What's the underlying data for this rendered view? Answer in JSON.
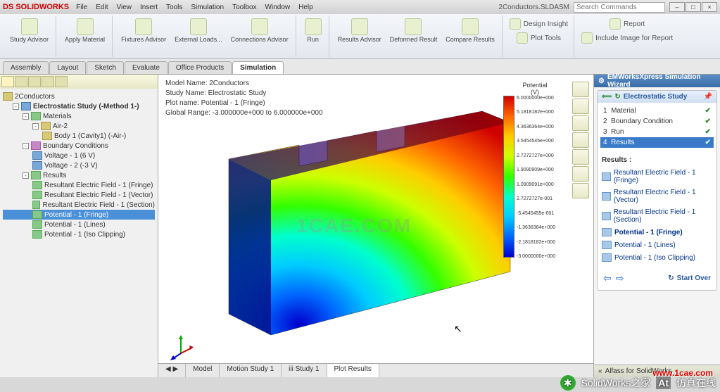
{
  "app": {
    "logo": "DS SOLIDWORKS",
    "document": "2Conductors.SLDASM",
    "search_placeholder": "Search Commands"
  },
  "menu": [
    "File",
    "Edit",
    "View",
    "Insert",
    "Tools",
    "Simulation",
    "Toolbox",
    "Window",
    "Help"
  ],
  "ribbon": {
    "study_advisor": "Study Advisor",
    "apply_material": "Apply Material",
    "fixtures_advisor": "Fixtures Advisor",
    "external_loads": "External Loads...",
    "connections_advisor": "Connections Advisor",
    "run": "Run",
    "results_advisor": "Results Advisor",
    "deformed_result": "Deformed Result",
    "compare_results": "Compare Results",
    "design_insight": "Design Insight",
    "plot_tools": "Plot Tools",
    "report": "Report",
    "include_image": "Include Image for Report"
  },
  "tabs": {
    "items": [
      "Assembly",
      "Layout",
      "Sketch",
      "Evaluate",
      "Office Products",
      "Simulation"
    ],
    "active": "Simulation"
  },
  "tree": {
    "root": "2Conductors",
    "study": "Electrostatic Study (-Method 1-)",
    "materials": "Materials",
    "air": "Air-2",
    "body": "Body 1 (Cavity1) (-Air-)",
    "boundary": "Boundary Conditions",
    "voltage1": "Voltage - 1 (6 V)",
    "voltage2": "Voltage - 2 (-3 V)",
    "results": "Results",
    "r1": "Resultant Electric Field - 1 (Fringe)",
    "r2": "Resultant Electric Field - 1 (Vector)",
    "r3": "Resultant Electric Field - 1 (Section)",
    "r4": "Potential - 1 (Fringe)",
    "r5": "Potential - 1 (Lines)",
    "r6": "Potential - 1 (Iso Clipping)"
  },
  "model_info": {
    "l1": "Model Name: 2Conductors",
    "l2": "Study Name: Electrostatic Study",
    "l3": "Plot name: Potential - 1 (Fringe)",
    "l4": "Global Range: -3.000000e+000 to 6.000000e+000"
  },
  "legend": {
    "title": "Potential",
    "unit": "(V)",
    "vals": [
      "6.0000000e+000",
      "5.1818182e+000",
      "4.3636364e+000",
      "3.5454545e+000",
      "2.7272727e+000",
      "1.9090909e+000",
      "1.0909091e+000",
      "2.7272727e-001",
      "-5.4545455e-001",
      "-1.3636364e+000",
      "-2.1818182e+000",
      "-3.0000000e+000"
    ]
  },
  "view_tabs": {
    "items": [
      "Model",
      "Motion Study 1",
      "iii  Study 1",
      "Plot Results"
    ],
    "active": "Plot Results"
  },
  "wizard": {
    "title": "EMWorksXpress Simulation Wizard",
    "header": "Electrostatic Study",
    "steps": [
      {
        "n": "1",
        "label": "Material",
        "done": true
      },
      {
        "n": "2",
        "label": "Boundary Condition",
        "done": true
      },
      {
        "n": "3",
        "label": "Run",
        "done": true
      },
      {
        "n": "4",
        "label": "Results",
        "done": true,
        "active": true
      }
    ],
    "results_title": "Results :",
    "results": [
      "Resultant Electric Field - 1 (Fringe)",
      "Resultant Electric Field - 1 (Vector)",
      "Resultant Electric Field - 1 (Section)",
      "Potential - 1 (Fringe)",
      "Potential - 1 (Lines)",
      "Potential - 1 (Iso Clipping)"
    ],
    "start_over": "Start Over",
    "addin": "Alfass for SolidWorks"
  },
  "watermark": "1CAE.COM",
  "footer": {
    "brand": "SolidWorks之家",
    "tag": "仿真在线",
    "url": "www.1cae.com"
  },
  "chart_data": {
    "type": "heatmap",
    "title": "Potential (V)",
    "colormap": "rainbow",
    "range": [
      -3.0,
      6.0
    ],
    "ticks": [
      6.0,
      5.18,
      4.36,
      3.55,
      2.73,
      1.91,
      1.09,
      0.27,
      -0.55,
      -1.36,
      -2.18,
      -3.0
    ],
    "description": "Electrostatic potential fringe plot on a notched rectangular slab. Left face ≈ -3V (blue), right face ≈ +6V (red), radial rainbow gradient emanating from a point near the bottom-left edge."
  }
}
